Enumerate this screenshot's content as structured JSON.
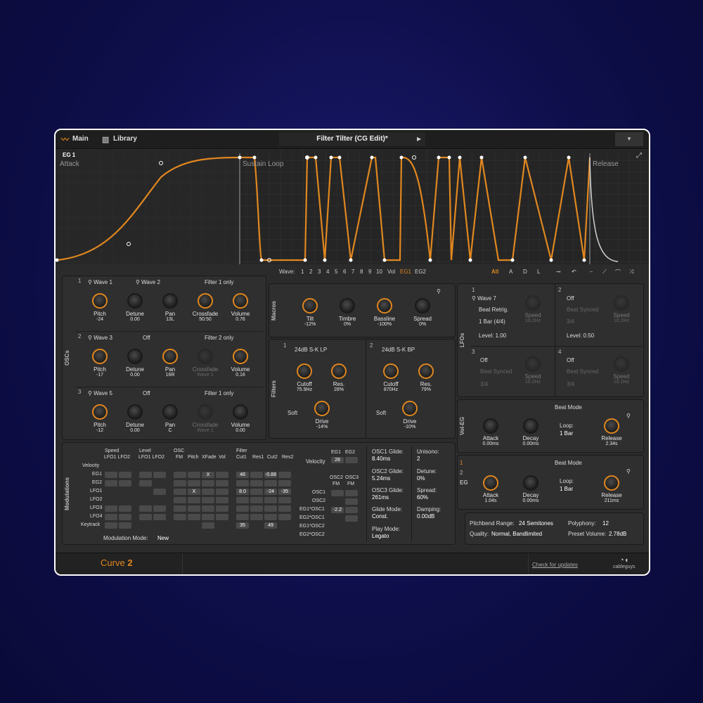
{
  "tabs": {
    "main": "Main",
    "library": "Library"
  },
  "preset": {
    "name": "Filter Tilter (CG Edit)*",
    "prev": "◀",
    "next": "▶",
    "menu": "▼"
  },
  "eg": {
    "title": "EG 1",
    "attack": "Attack",
    "sustain": "Sustain Loop",
    "release": "Release"
  },
  "waverow": {
    "label": "Wave:",
    "items": [
      "1",
      "2",
      "3",
      "4",
      "5",
      "6",
      "7",
      "8",
      "9",
      "10",
      "Vol",
      "EG1",
      "EG2"
    ],
    "all": "All",
    "a": "A",
    "d": "D",
    "l": "L"
  },
  "oscs": {
    "side": "OSCs",
    "rows": [
      {
        "num": "1",
        "wave_a": "Wave 1",
        "wave_b": "Wave 2",
        "filter": "Filter 1 only",
        "knobs": [
          {
            "label": "Pitch",
            "value": "-24"
          },
          {
            "label": "Detune",
            "value": "0.00"
          },
          {
            "label": "Pan",
            "value": "13L"
          },
          {
            "label": "Crossfade",
            "value": "50:50"
          },
          {
            "label": "Volume",
            "value": "0.76"
          }
        ]
      },
      {
        "num": "2",
        "wave_a": "Wave 3",
        "wave_b": "Off",
        "filter": "Filter 2 only",
        "knobs": [
          {
            "label": "Pitch",
            "value": "-17"
          },
          {
            "label": "Detune",
            "value": "0.00"
          },
          {
            "label": "Pan",
            "value": "16R"
          },
          {
            "label": "Crossfade",
            "value": "Wave 1"
          },
          {
            "label": "Volume",
            "value": "0.16"
          }
        ]
      },
      {
        "num": "3",
        "wave_a": "Wave 5",
        "wave_b": "Off",
        "filter": "Filter 1 only",
        "knobs": [
          {
            "label": "Pitch",
            "value": "-12"
          },
          {
            "label": "Detune",
            "value": "0.00"
          },
          {
            "label": "Pan",
            "value": "C"
          },
          {
            "label": "Crossfade",
            "value": "Wave 1"
          },
          {
            "label": "Volume",
            "value": "0.00"
          }
        ]
      }
    ]
  },
  "macros": {
    "side": "Macros",
    "knobs": [
      {
        "label": "Tilt",
        "value": "-12%"
      },
      {
        "label": "Timbre",
        "value": "0%"
      },
      {
        "label": "Bassline",
        "value": "-100%"
      },
      {
        "label": "Spread",
        "value": "0%"
      }
    ]
  },
  "filters": {
    "side": "Filters",
    "f1": {
      "num": "1",
      "type": "24dB S-K LP",
      "cutoff_label": "Cutoff",
      "cutoff": "75.9Hz",
      "res_label": "Res.",
      "res": "28%",
      "soft": "Soft",
      "drive_label": "Drive",
      "drive": "-14%"
    },
    "f2": {
      "num": "2",
      "type": "24dB S-K BP",
      "cutoff_label": "Cutoff",
      "cutoff": "870Hz",
      "res_label": "Res.",
      "res": "79%",
      "soft": "Soft",
      "drive_label": "Drive",
      "drive": "-10%"
    }
  },
  "lfos": {
    "side": "LFOs",
    "l1": {
      "num": "1",
      "wave": "Wave 7",
      "mode": "Beat Retrig.",
      "rate": "1 Bar (4/4)",
      "level": "Level: 1.00",
      "speed": "Speed",
      "speed_val": "10.2Hz"
    },
    "l2": {
      "num": "2",
      "wave": "Off",
      "mode": "Beat Synced",
      "rate": "3/4",
      "level": "Level: 0.50",
      "speed": "Speed",
      "speed_val": "10.2Hz"
    },
    "l3": {
      "num": "3",
      "wave": "Off",
      "mode": "Beat Synced",
      "rate": "3/4",
      "speed": "Speed",
      "speed_val": "10.2Hz"
    },
    "l4": {
      "num": "4",
      "wave": "Off",
      "mode": "Beat Synced",
      "rate": "3/4",
      "speed": "Speed",
      "speed_val": "10.2Hz"
    }
  },
  "voleg": {
    "side": "Vol-EG",
    "mode": "Beat Mode",
    "attack_label": "Attack",
    "attack": "0.00ms",
    "decay_label": "Decay",
    "decay": "0.00ms",
    "loop": "Loop:",
    "loop_val": "1 Bar",
    "release_label": "Release",
    "release": "2.34s"
  },
  "eg2": {
    "side": "EG",
    "num1": "1",
    "num2": "2",
    "mode": "Beat Mode",
    "attack_label": "Attack",
    "attack": "1.04s",
    "decay_label": "Decay",
    "decay": "0.00ms",
    "loop": "Loop:",
    "loop_val": "1 Bar",
    "release_label": "Release",
    "release": "211ms"
  },
  "mods": {
    "side": "Modulations",
    "groups": [
      {
        "label": "Speed",
        "sub": "LFO1 LFO2"
      },
      {
        "label": "Level",
        "sub": "LFO1 LFO2"
      },
      {
        "label": "OSC",
        "sub": "FM"
      },
      {
        "label": "Pitch"
      },
      {
        "label": "XFade"
      },
      {
        "label": "Vol"
      },
      {
        "label": "Filter",
        "sub": "Cut1"
      },
      {
        "label": "Res1"
      },
      {
        "label": "Cut2"
      },
      {
        "label": "Res2"
      }
    ],
    "sources": [
      "Velocity",
      "EG1",
      "EG2",
      "LFO1",
      "LFO2",
      "LFO3",
      "LFO4",
      "Keytrack"
    ],
    "values": {
      "eg1_xfade": "X",
      "eg1_res1": "48",
      "eg1_cut2": "-0.88",
      "lfo1_pitch": "X",
      "lfo1_cut1": "8.0",
      "lfo1_cut2": "-24",
      "lfo1_res2": "-35",
      "key_cut1": "35",
      "key_cut2": "49"
    },
    "mode_label": "Modulation Mode:",
    "mode": "New",
    "vel": {
      "label": "Velocity",
      "eg1": "EG1",
      "eg2": "EG2",
      "val": "28"
    },
    "fm": {
      "h1": "OSC2",
      "h2": "OSC3",
      "sub": "FM",
      "rows": [
        "OSC1",
        "OSC2",
        "EG1*OSC1",
        "EG2*OSC1",
        "EG1*OSC2",
        "EG2*OSC2"
      ],
      "val": "-2.2"
    },
    "glide": [
      {
        "label": "OSC1 Glide:",
        "value": "8.40ms"
      },
      {
        "label": "OSC2 Glide:",
        "value": "5.24ms"
      },
      {
        "label": "OSC3 Glide:",
        "value": "261ms"
      },
      {
        "label": "Glide Mode:",
        "value": "Const."
      },
      {
        "label": "Play Mode:",
        "value": "Legato"
      }
    ],
    "uni": [
      {
        "label": "Unisono:",
        "value": "2"
      },
      {
        "label": "Detune:",
        "value": "0%"
      },
      {
        "label": "Spread:",
        "value": "60%"
      },
      {
        "label": "Damping:",
        "value": "0.00dB"
      }
    ]
  },
  "global": {
    "pb_label": "Pitchbend Range:",
    "pb": "24 Semitones",
    "poly_label": "Polyphony:",
    "poly": "12",
    "q_label": "Quality:",
    "q": "Normal, Bandlimited",
    "pv_label": "Preset Volume:",
    "pv": "2.78dB"
  },
  "bottom": {
    "curve": "Curve",
    "curve_num": "2",
    "update": "Check for updates",
    "logo": "cableguys"
  }
}
